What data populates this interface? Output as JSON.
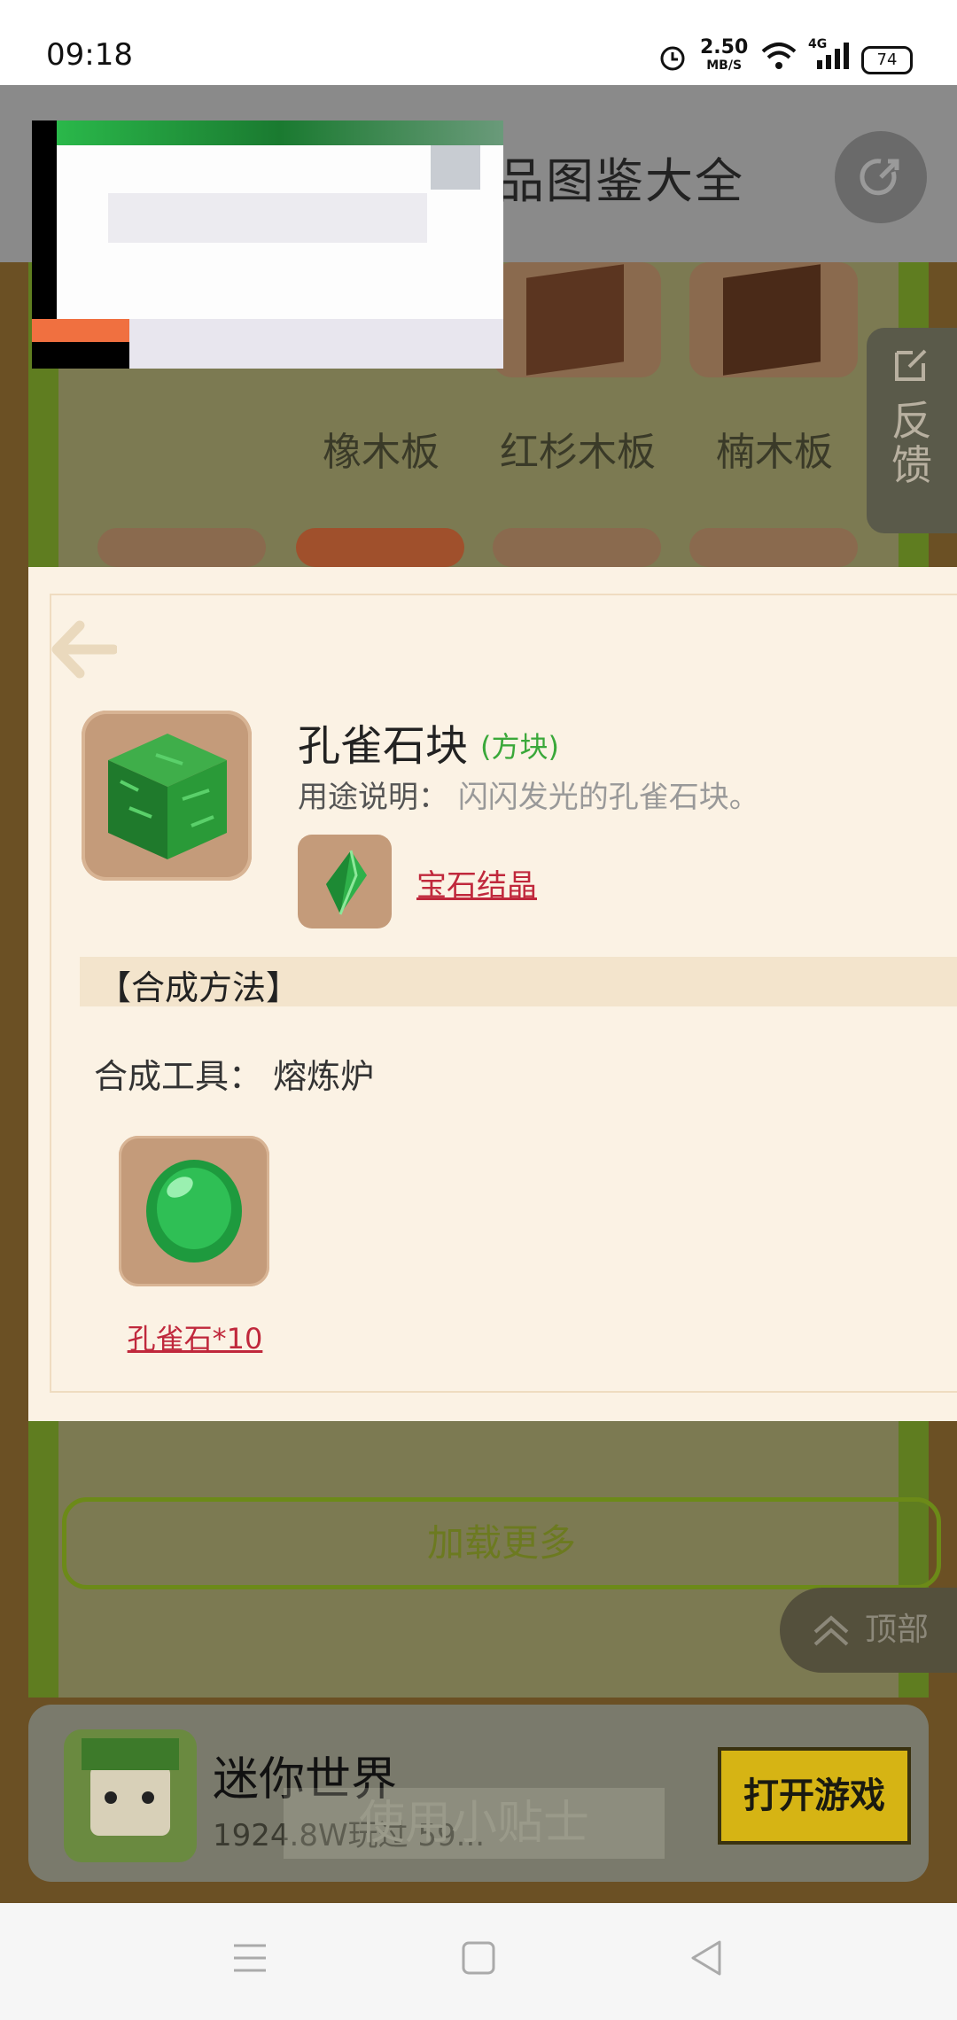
{
  "status_bar": {
    "time": "09:18",
    "speed": "2.50",
    "speed_unit": "MB/S",
    "network": "4G",
    "battery": "74"
  },
  "header": {
    "title": "品图鉴大全"
  },
  "feedback": {
    "label": "反馈"
  },
  "grid": {
    "labels": [
      "橡木板",
      "红杉木板",
      "楠木板"
    ]
  },
  "load_more": "加载更多",
  "top_button": "顶部",
  "ad": {
    "game_name": "迷你世界",
    "stats": "1924.8W玩过 59...",
    "open_button": "打开游戏",
    "tip": "使用小贴士"
  },
  "modal": {
    "item_name": "孔雀石块",
    "item_type": "(方块)",
    "usage_label": "用途说明：",
    "usage_text": "闪闪发光的孔雀石块。",
    "related_item": "宝石结晶",
    "section_title": "【合成方法】",
    "tool_label": "合成工具：",
    "tool_value": "熔炼炉",
    "ingredient": "孔雀石*10"
  },
  "colors": {
    "accent_green": "#3aa83a",
    "link_red": "#c0283c",
    "modal_bg": "#fbf2e4",
    "button_yellow": "#d6b414"
  }
}
